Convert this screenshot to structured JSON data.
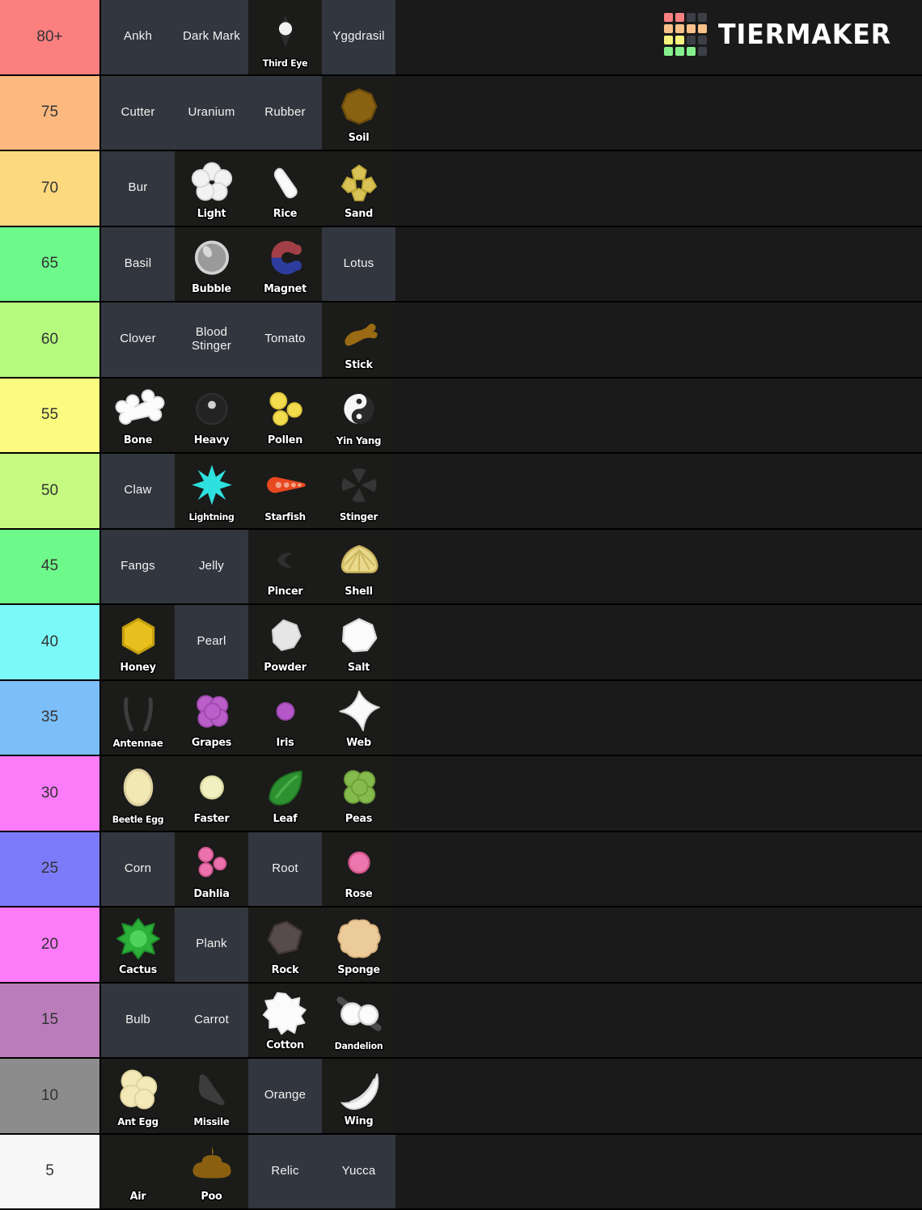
{
  "brand": {
    "name": "TIERMAKER",
    "logo_icon": "tiermaker-grid-logo",
    "logo_colors": [
      "#f98080",
      "#f98080",
      "#3c3f45",
      "#3c3f45",
      "#f9c089",
      "#f9c089",
      "#f9c089",
      "#f9c089",
      "#f7f27f",
      "#f7f27f",
      "#3c3f45",
      "#3c3f45",
      "#86f08c",
      "#86f08c",
      "#86f08c",
      "#3c3f45"
    ]
  },
  "tiers": [
    {
      "label": "80+",
      "color": "#fc7f7f",
      "items": [
        {
          "name": "Ankh",
          "icon": null
        },
        {
          "name": "Dark Mark",
          "icon": null
        },
        {
          "name": "Third Eye",
          "icon": "third-eye-icon"
        },
        {
          "name": "Yggdrasil",
          "icon": null
        }
      ]
    },
    {
      "label": "75",
      "color": "#fcb97f",
      "items": [
        {
          "name": "Cutter",
          "icon": null
        },
        {
          "name": "Uranium",
          "icon": null
        },
        {
          "name": "Rubber",
          "icon": null
        },
        {
          "name": "Soil",
          "icon": "soil-icon"
        }
      ]
    },
    {
      "label": "70",
      "color": "#fcd87f",
      "items": [
        {
          "name": "Bur",
          "icon": null
        },
        {
          "name": "Light",
          "icon": "light-icon"
        },
        {
          "name": "Rice",
          "icon": "rice-icon"
        },
        {
          "name": "Sand",
          "icon": "sand-icon"
        }
      ]
    },
    {
      "label": "65",
      "color": "#6ef98b",
      "items": [
        {
          "name": "Basil",
          "icon": null
        },
        {
          "name": "Bubble",
          "icon": "bubble-icon"
        },
        {
          "name": "Magnet",
          "icon": "magnet-icon"
        },
        {
          "name": "Lotus",
          "icon": null
        }
      ]
    },
    {
      "label": "60",
      "color": "#b6f97f",
      "items": [
        {
          "name": "Clover",
          "icon": null
        },
        {
          "name": "Blood Stinger",
          "icon": null
        },
        {
          "name": "Tomato",
          "icon": null
        },
        {
          "name": "Stick",
          "icon": "stick-icon"
        }
      ]
    },
    {
      "label": "55",
      "color": "#fafb7f",
      "items": [
        {
          "name": "Bone",
          "icon": "bone-icon"
        },
        {
          "name": "Heavy",
          "icon": "heavy-icon"
        },
        {
          "name": "Pollen",
          "icon": "pollen-icon"
        },
        {
          "name": "Yin Yang",
          "icon": "yin-yang-icon"
        }
      ]
    },
    {
      "label": "50",
      "color": "#c6f97f",
      "items": [
        {
          "name": "Claw",
          "icon": null
        },
        {
          "name": "Lightning",
          "icon": "lightning-icon"
        },
        {
          "name": "Starfish",
          "icon": "starfish-icon"
        },
        {
          "name": "Stinger",
          "icon": "stinger-icon"
        }
      ]
    },
    {
      "label": "45",
      "color": "#6ef98b",
      "items": [
        {
          "name": "Fangs",
          "icon": null
        },
        {
          "name": "Jelly",
          "icon": null
        },
        {
          "name": "Pincer",
          "icon": "pincer-icon"
        },
        {
          "name": "Shell",
          "icon": "shell-icon"
        }
      ]
    },
    {
      "label": "40",
      "color": "#7bf9f9",
      "items": [
        {
          "name": "Honey",
          "icon": "honey-icon"
        },
        {
          "name": "Pearl",
          "icon": null
        },
        {
          "name": "Powder",
          "icon": "powder-icon"
        },
        {
          "name": "Salt",
          "icon": "salt-icon"
        }
      ]
    },
    {
      "label": "35",
      "color": "#7bbef9",
      "items": [
        {
          "name": "Antennae",
          "icon": "antennae-icon"
        },
        {
          "name": "Grapes",
          "icon": "grapes-icon"
        },
        {
          "name": "Iris",
          "icon": "iris-icon"
        },
        {
          "name": "Web",
          "icon": "web-icon"
        }
      ]
    },
    {
      "label": "30",
      "color": "#fb7bf9",
      "items": [
        {
          "name": "Beetle Egg",
          "icon": "beetle-egg-icon"
        },
        {
          "name": "Faster",
          "icon": "faster-icon"
        },
        {
          "name": "Leaf",
          "icon": "leaf-icon"
        },
        {
          "name": "Peas",
          "icon": "peas-icon"
        }
      ]
    },
    {
      "label": "25",
      "color": "#7b7bf9",
      "items": [
        {
          "name": "Corn",
          "icon": null
        },
        {
          "name": "Dahlia",
          "icon": "dahlia-icon"
        },
        {
          "name": "Root",
          "icon": null
        },
        {
          "name": "Rose",
          "icon": "rose-icon"
        }
      ]
    },
    {
      "label": "20",
      "color": "#fb7bf9",
      "items": [
        {
          "name": "Cactus",
          "icon": "cactus-icon"
        },
        {
          "name": "Plank",
          "icon": null
        },
        {
          "name": "Rock",
          "icon": "rock-icon"
        },
        {
          "name": "Sponge",
          "icon": "sponge-icon"
        }
      ]
    },
    {
      "label": "15",
      "color": "#bb7cbb",
      "items": [
        {
          "name": "Bulb",
          "icon": null
        },
        {
          "name": "Carrot",
          "icon": null
        },
        {
          "name": "Cotton",
          "icon": "cotton-icon"
        },
        {
          "name": "Dandelion",
          "icon": "dandelion-icon"
        }
      ]
    },
    {
      "label": "10",
      "color": "#8c8c8c",
      "items": [
        {
          "name": "Ant Egg",
          "icon": "ant-egg-icon"
        },
        {
          "name": "Missile",
          "icon": "missile-icon"
        },
        {
          "name": "Orange",
          "icon": null
        },
        {
          "name": "Wing",
          "icon": "wing-icon"
        }
      ]
    },
    {
      "label": "5",
      "color": "#f7f7f7",
      "items": [
        {
          "name": "Air",
          "icon": "air-icon"
        },
        {
          "name": "Poo",
          "icon": "poo-icon"
        },
        {
          "name": "Relic",
          "icon": null
        },
        {
          "name": "Yucca",
          "icon": null
        }
      ]
    }
  ]
}
